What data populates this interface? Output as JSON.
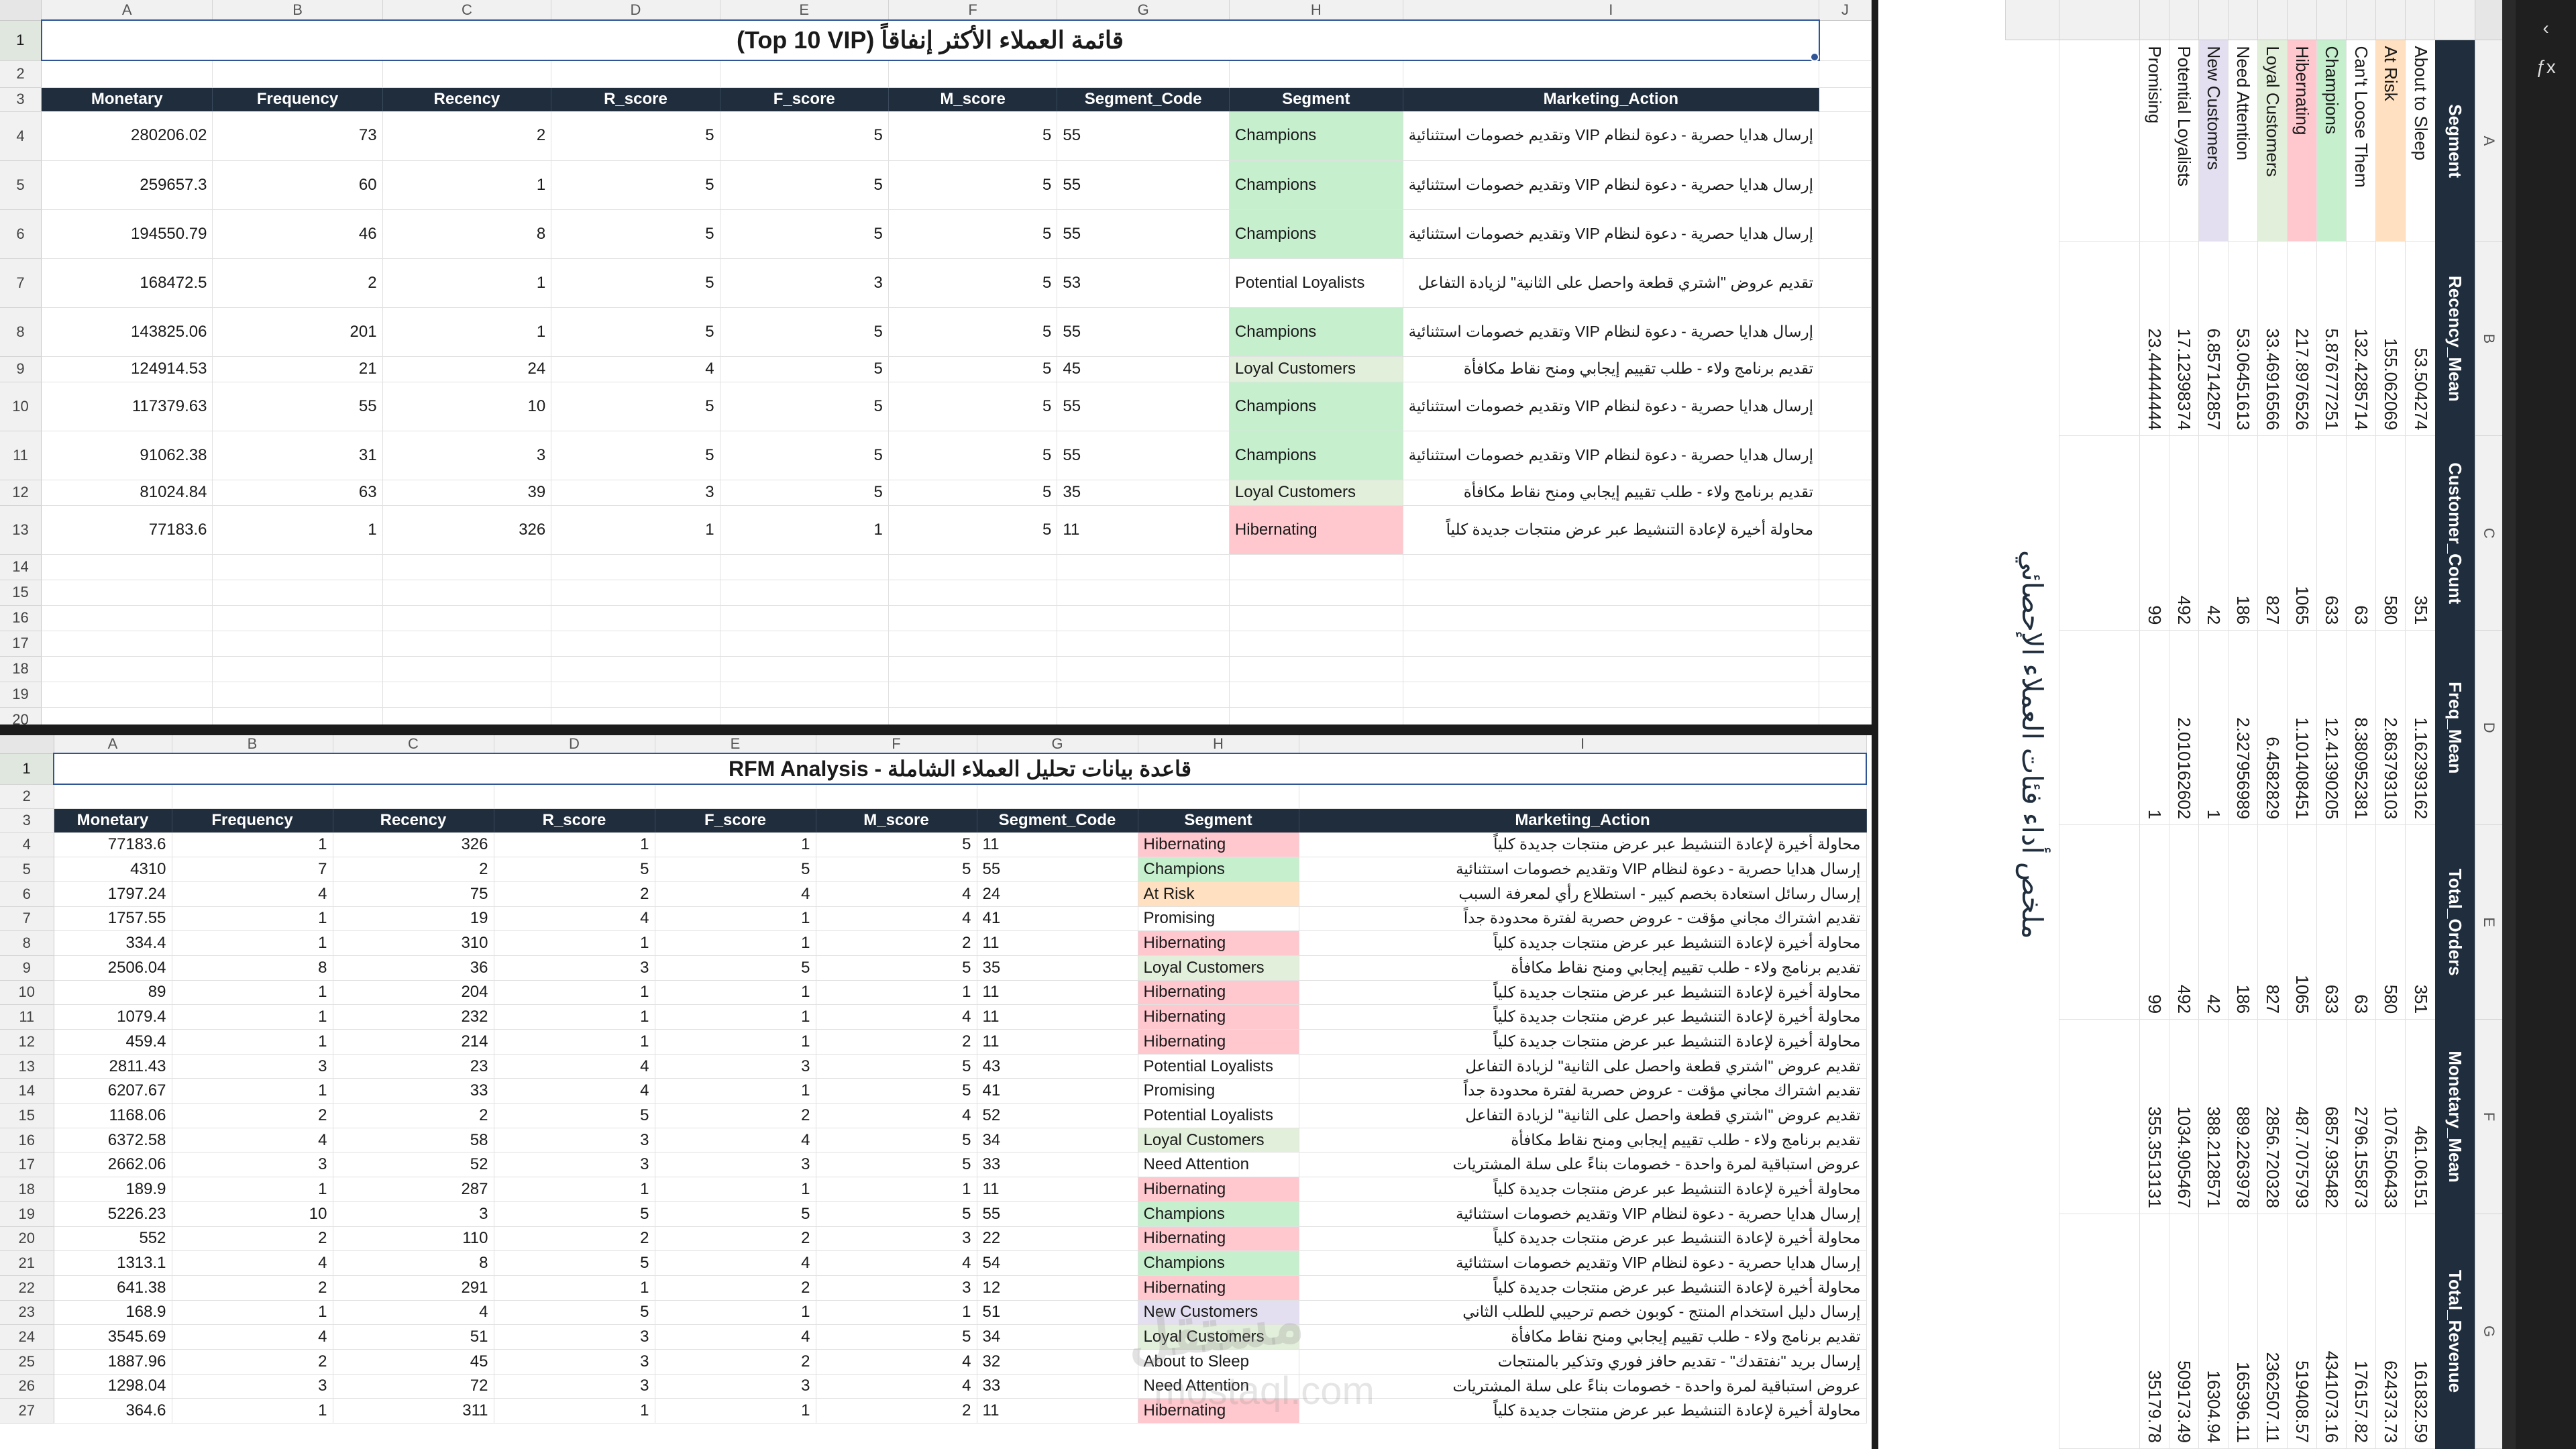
{
  "columns": [
    "A",
    "B",
    "C",
    "D",
    "E",
    "F",
    "G",
    "H",
    "I",
    "J"
  ],
  "vip": {
    "title": "قائمة العملاء الأكثر إنفاقاً (Top 10 VIP)",
    "headers": [
      "Monetary",
      "Frequency",
      "Recency",
      "R_score",
      "F_score",
      "M_score",
      "Segment_Code",
      "Segment",
      "Marketing_Action"
    ],
    "rows": [
      {
        "n": "4",
        "m": "280206.02",
        "f": "73",
        "r": "2",
        "rs": "5",
        "fs": "5",
        "ms": "5",
        "code": "55",
        "seg": "Champions",
        "act": "إرسال هدايا حصرية - دعوة لنظام VIP وتقديم خصومات استثنائية"
      },
      {
        "n": "5",
        "m": "259657.3",
        "f": "60",
        "r": "1",
        "rs": "5",
        "fs": "5",
        "ms": "5",
        "code": "55",
        "seg": "Champions",
        "act": "إرسال هدايا حصرية - دعوة لنظام VIP وتقديم خصومات استثنائية"
      },
      {
        "n": "6",
        "m": "194550.79",
        "f": "46",
        "r": "8",
        "rs": "5",
        "fs": "5",
        "ms": "5",
        "code": "55",
        "seg": "Champions",
        "act": "إرسال هدايا حصرية - دعوة لنظام VIP وتقديم خصومات استثنائية"
      },
      {
        "n": "7",
        "m": "168472.5",
        "f": "2",
        "r": "1",
        "rs": "5",
        "fs": "3",
        "ms": "5",
        "code": "53",
        "seg": "Potential Loyalists",
        "act": "تقديم عروض \"اشتري قطعة واحصل على الثانية\" لزيادة التفاعل"
      },
      {
        "n": "8",
        "m": "143825.06",
        "f": "201",
        "r": "1",
        "rs": "5",
        "fs": "5",
        "ms": "5",
        "code": "55",
        "seg": "Champions",
        "act": "إرسال هدايا حصرية - دعوة لنظام VIP وتقديم خصومات استثنائية"
      },
      {
        "n": "9",
        "m": "124914.53",
        "f": "21",
        "r": "24",
        "rs": "4",
        "fs": "5",
        "ms": "5",
        "code": "45",
        "seg": "Loyal Customers",
        "act": "تقديم برنامج ولاء - طلب تقييم إيجابي ومنح نقاط مكافأة"
      },
      {
        "n": "10",
        "m": "117379.63",
        "f": "55",
        "r": "10",
        "rs": "5",
        "fs": "5",
        "ms": "5",
        "code": "55",
        "seg": "Champions",
        "act": "إرسال هدايا حصرية - دعوة لنظام VIP وتقديم خصومات استثنائية"
      },
      {
        "n": "11",
        "m": "91062.38",
        "f": "31",
        "r": "3",
        "rs": "5",
        "fs": "5",
        "ms": "5",
        "code": "55",
        "seg": "Champions",
        "act": "إرسال هدايا حصرية - دعوة لنظام VIP وتقديم خصومات استثنائية"
      },
      {
        "n": "12",
        "m": "81024.84",
        "f": "63",
        "r": "39",
        "rs": "3",
        "fs": "5",
        "ms": "5",
        "code": "35",
        "seg": "Loyal Customers",
        "act": "تقديم برنامج ولاء - طلب تقييم إيجابي ومنح نقاط مكافأة"
      },
      {
        "n": "13",
        "m": "77183.6",
        "f": "1",
        "r": "326",
        "rs": "1",
        "fs": "1",
        "ms": "5",
        "code": "11",
        "seg": "Hibernating",
        "act": "محاولة أخيرة لإعادة التنشيط عبر عرض منتجات جديدة كلياً"
      }
    ],
    "empty_rows": [
      "14",
      "15",
      "16",
      "17",
      "18",
      "19",
      "20"
    ]
  },
  "rfm": {
    "title": "قاعدة بيانات تحليل العملاء الشاملة - RFM Analysis",
    "headers": [
      "Monetary",
      "Frequency",
      "Recency",
      "R_score",
      "F_score",
      "M_score",
      "Segment_Code",
      "Segment",
      "Marketing_Action"
    ],
    "rows": [
      {
        "n": "4",
        "m": "77183.6",
        "f": "1",
        "r": "326",
        "rs": "1",
        "fs": "1",
        "ms": "5",
        "code": "11",
        "seg": "Hibernating",
        "act": "محاولة أخيرة لإعادة التنشيط عبر عرض منتجات جديدة كلياً"
      },
      {
        "n": "5",
        "m": "4310",
        "f": "7",
        "r": "2",
        "rs": "5",
        "fs": "5",
        "ms": "5",
        "code": "55",
        "seg": "Champions",
        "act": "إرسال هدايا حصرية - دعوة لنظام VIP وتقديم خصومات استثنائية"
      },
      {
        "n": "6",
        "m": "1797.24",
        "f": "4",
        "r": "75",
        "rs": "2",
        "fs": "4",
        "ms": "4",
        "code": "24",
        "seg": "At Risk",
        "act": "إرسال رسائل استعادة بخصم كبير - استطلاع رأي لمعرفة السبب"
      },
      {
        "n": "7",
        "m": "1757.55",
        "f": "1",
        "r": "19",
        "rs": "4",
        "fs": "1",
        "ms": "4",
        "code": "41",
        "seg": "Promising",
        "act": "تقديم اشتراك مجاني مؤقت - عروض حصرية لفترة محدودة جداً"
      },
      {
        "n": "8",
        "m": "334.4",
        "f": "1",
        "r": "310",
        "rs": "1",
        "fs": "1",
        "ms": "2",
        "code": "11",
        "seg": "Hibernating",
        "act": "محاولة أخيرة لإعادة التنشيط عبر عرض منتجات جديدة كلياً"
      },
      {
        "n": "9",
        "m": "2506.04",
        "f": "8",
        "r": "36",
        "rs": "3",
        "fs": "5",
        "ms": "5",
        "code": "35",
        "seg": "Loyal Customers",
        "act": "تقديم برنامج ولاء - طلب تقييم إيجابي ومنح نقاط مكافأة"
      },
      {
        "n": "10",
        "m": "89",
        "f": "1",
        "r": "204",
        "rs": "1",
        "fs": "1",
        "ms": "1",
        "code": "11",
        "seg": "Hibernating",
        "act": "محاولة أخيرة لإعادة التنشيط عبر عرض منتجات جديدة كلياً"
      },
      {
        "n": "11",
        "m": "1079.4",
        "f": "1",
        "r": "232",
        "rs": "1",
        "fs": "1",
        "ms": "4",
        "code": "11",
        "seg": "Hibernating",
        "act": "محاولة أخيرة لإعادة التنشيط عبر عرض منتجات جديدة كلياً"
      },
      {
        "n": "12",
        "m": "459.4",
        "f": "1",
        "r": "214",
        "rs": "1",
        "fs": "1",
        "ms": "2",
        "code": "11",
        "seg": "Hibernating",
        "act": "محاولة أخيرة لإعادة التنشيط عبر عرض منتجات جديدة كلياً"
      },
      {
        "n": "13",
        "m": "2811.43",
        "f": "3",
        "r": "23",
        "rs": "4",
        "fs": "3",
        "ms": "5",
        "code": "43",
        "seg": "Potential Loyalists",
        "act": "تقديم عروض \"اشتري قطعة واحصل على الثانية\" لزيادة التفاعل"
      },
      {
        "n": "14",
        "m": "6207.67",
        "f": "1",
        "r": "33",
        "rs": "4",
        "fs": "1",
        "ms": "5",
        "code": "41",
        "seg": "Promising",
        "act": "تقديم اشتراك مجاني مؤقت - عروض حصرية لفترة محدودة جداً"
      },
      {
        "n": "15",
        "m": "1168.06",
        "f": "2",
        "r": "2",
        "rs": "5",
        "fs": "2",
        "ms": "4",
        "code": "52",
        "seg": "Potential Loyalists",
        "act": "تقديم عروض \"اشتري قطعة واحصل على الثانية\" لزيادة التفاعل"
      },
      {
        "n": "16",
        "m": "6372.58",
        "f": "4",
        "r": "58",
        "rs": "3",
        "fs": "4",
        "ms": "5",
        "code": "34",
        "seg": "Loyal Customers",
        "act": "تقديم برنامج ولاء - طلب تقييم إيجابي ومنح نقاط مكافأة"
      },
      {
        "n": "17",
        "m": "2662.06",
        "f": "3",
        "r": "52",
        "rs": "3",
        "fs": "3",
        "ms": "5",
        "code": "33",
        "seg": "Need Attention",
        "act": "عروض استباقية لمرة واحدة - خصومات بناءً على سلة المشتريات"
      },
      {
        "n": "18",
        "m": "189.9",
        "f": "1",
        "r": "287",
        "rs": "1",
        "fs": "1",
        "ms": "1",
        "code": "11",
        "seg": "Hibernating",
        "act": "محاولة أخيرة لإعادة التنشيط عبر عرض منتجات جديدة كلياً"
      },
      {
        "n": "19",
        "m": "5226.23",
        "f": "10",
        "r": "3",
        "rs": "5",
        "fs": "5",
        "ms": "5",
        "code": "55",
        "seg": "Champions",
        "act": "إرسال هدايا حصرية - دعوة لنظام VIP وتقديم خصومات استثنائية"
      },
      {
        "n": "20",
        "m": "552",
        "f": "2",
        "r": "110",
        "rs": "2",
        "fs": "2",
        "ms": "3",
        "code": "22",
        "seg": "Hibernating",
        "act": "محاولة أخيرة لإعادة التنشيط عبر عرض منتجات جديدة كلياً"
      },
      {
        "n": "21",
        "m": "1313.1",
        "f": "4",
        "r": "8",
        "rs": "5",
        "fs": "4",
        "ms": "4",
        "code": "54",
        "seg": "Champions",
        "act": "إرسال هدايا حصرية - دعوة لنظام VIP وتقديم خصومات استثنائية"
      },
      {
        "n": "22",
        "m": "641.38",
        "f": "2",
        "r": "291",
        "rs": "1",
        "fs": "2",
        "ms": "3",
        "code": "12",
        "seg": "Hibernating",
        "act": "محاولة أخيرة لإعادة التنشيط عبر عرض منتجات جديدة كلياً"
      },
      {
        "n": "23",
        "m": "168.9",
        "f": "1",
        "r": "4",
        "rs": "5",
        "fs": "1",
        "ms": "1",
        "code": "51",
        "seg": "New Customers",
        "act": "إرسال دليل استخدام المنتج - كوبون خصم ترحيبي للطلب الثاني"
      },
      {
        "n": "24",
        "m": "3545.69",
        "f": "4",
        "r": "51",
        "rs": "3",
        "fs": "4",
        "ms": "5",
        "code": "34",
        "seg": "Loyal Customers",
        "act": "تقديم برنامج ولاء - طلب تقييم إيجابي ومنح نقاط مكافأة"
      },
      {
        "n": "25",
        "m": "1887.96",
        "f": "2",
        "r": "45",
        "rs": "3",
        "fs": "2",
        "ms": "4",
        "code": "32",
        "seg": "About to Sleep",
        "act": "إرسال بريد \"نفتقدك\" - تقديم حافز فوري وتذكير بالمنتجات"
      },
      {
        "n": "26",
        "m": "1298.04",
        "f": "3",
        "r": "72",
        "rs": "3",
        "fs": "3",
        "ms": "4",
        "code": "33",
        "seg": "Need Attention",
        "act": "عروض استباقية لمرة واحدة - خصومات بناءً على سلة المشتريات"
      },
      {
        "n": "27",
        "m": "364.6",
        "f": "1",
        "r": "311",
        "rs": "1",
        "fs": "1",
        "ms": "2",
        "code": "11",
        "seg": "Hibernating",
        "act": "محاولة أخيرة لإعادة التنشيط عبر عرض منتجات جديدة كلياً"
      }
    ]
  },
  "summary": {
    "title": "ملخص أداء فئات العملاء الإحصائي",
    "headers": [
      "Segment",
      "Recency_Mean",
      "Customer_Count",
      "Freq_Mean",
      "Total_Orders",
      "Monetary_Mean",
      "Total_Revenue"
    ],
    "rows": [
      {
        "seg": "About to Sleep",
        "rec": "53.504274",
        "cnt": "351",
        "freq": "1.162393162",
        "ord": "351",
        "mon": "461.06151",
        "rev": "161832.59"
      },
      {
        "seg": "At Risk",
        "rec": "155.062069",
        "cnt": "580",
        "freq": "2.863793103",
        "ord": "580",
        "mon": "1076.506433",
        "rev": "624373.73"
      },
      {
        "seg": "Can't Loose Them",
        "rec": "132.4285714",
        "cnt": "63",
        "freq": "8.380952381",
        "ord": "63",
        "mon": "2796.155873",
        "rev": "176157.82"
      },
      {
        "seg": "Champions",
        "rec": "5.876777251",
        "cnt": "633",
        "freq": "12.41390205",
        "ord": "633",
        "mon": "6857.935482",
        "rev": "4341073.16"
      },
      {
        "seg": "Hibernating",
        "rec": "217.8976526",
        "cnt": "1065",
        "freq": "1.101408451",
        "ord": "1065",
        "mon": "487.7075793",
        "rev": "519408.57"
      },
      {
        "seg": "Loyal Customers",
        "rec": "33.46916566",
        "cnt": "827",
        "freq": "6.4582829",
        "ord": "827",
        "mon": "2856.720328",
        "rev": "2362507.11"
      },
      {
        "seg": "Need Attention",
        "rec": "53.06451613",
        "cnt": "186",
        "freq": "2.327956989",
        "ord": "186",
        "mon": "889.2263978",
        "rev": "165396.11"
      },
      {
        "seg": "New Customers",
        "rec": "6.857142857",
        "cnt": "42",
        "freq": "1",
        "ord": "42",
        "mon": "388.2128571",
        "rev": "16304.94"
      },
      {
        "seg": "Potential Loyalists",
        "rec": "17.12398374",
        "cnt": "492",
        "freq": "2.010162602",
        "ord": "492",
        "mon": "1034.905467",
        "rev": "509173.49"
      },
      {
        "seg": "Promising",
        "rec": "23.44444444",
        "cnt": "99",
        "freq": "1",
        "ord": "99",
        "mon": "355.3513131",
        "rev": "35179.78"
      }
    ]
  },
  "watermark": {
    "main": "مستقل",
    "sub": "mostaql.com"
  },
  "colors": {
    "header_bg": "#1f2d3d",
    "champions": "#c6efce",
    "hibernating": "#ffc7ce",
    "at_risk": "#ffe0c0",
    "selection": "#2f5597"
  }
}
